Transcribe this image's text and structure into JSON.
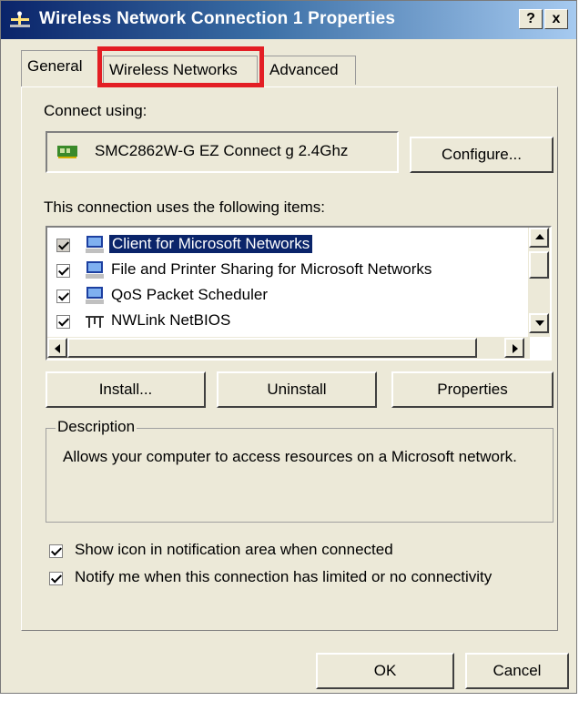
{
  "window": {
    "title": "Wireless Network Connection 1 Properties",
    "help_label": "?",
    "close_label": "x"
  },
  "tabs": [
    {
      "label": "General"
    },
    {
      "label": "Wireless Networks"
    },
    {
      "label": "Advanced"
    }
  ],
  "connect": {
    "label": "Connect using:",
    "adapter": "SMC2862W-G EZ Connect g 2.4Ghz",
    "configure_label": "Configure..."
  },
  "items": {
    "label": "This connection uses the following items:",
    "list": [
      {
        "label": "Client for Microsoft Networks",
        "checked": true,
        "selected": true,
        "icon": "network-client-icon"
      },
      {
        "label": "File and Printer Sharing for Microsoft Networks",
        "checked": true,
        "selected": false,
        "icon": "network-service-icon"
      },
      {
        "label": "QoS Packet Scheduler",
        "checked": true,
        "selected": false,
        "icon": "network-service-icon"
      },
      {
        "label": "NWLink NetBIOS",
        "checked": true,
        "selected": false,
        "icon": "protocol-icon"
      }
    ],
    "install_label": "Install...",
    "uninstall_label": "Uninstall",
    "properties_label": "Properties"
  },
  "description": {
    "legend": "Description",
    "text": "Allows your computer to access resources on a Microsoft network."
  },
  "options": [
    {
      "label": "Show icon in notification area when connected",
      "checked": true
    },
    {
      "label": "Notify me when this connection has limited or no connectivity",
      "checked": true
    }
  ],
  "footer": {
    "ok_label": "OK",
    "cancel_label": "Cancel"
  },
  "colors": {
    "highlight_border": "#e31e24",
    "title_gradient_start": "#0a246a",
    "selection": "#0a246a",
    "dialog_face": "#ece9d8"
  }
}
